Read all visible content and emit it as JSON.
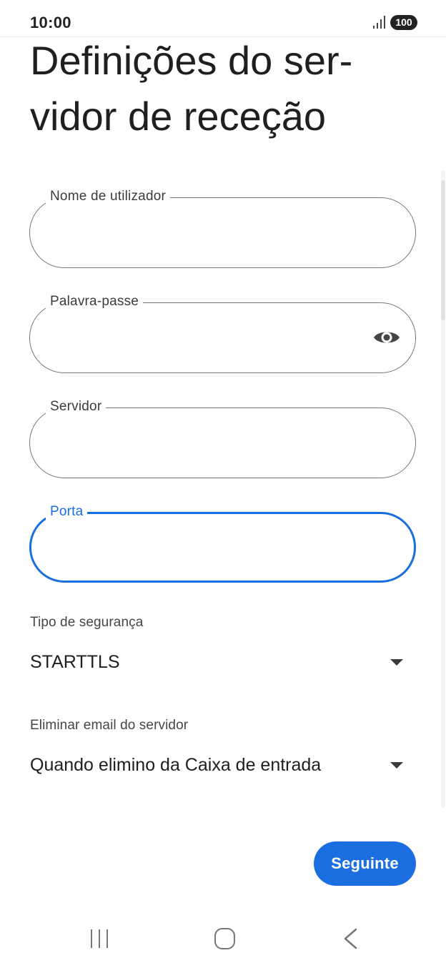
{
  "status_bar": {
    "time": "10:00",
    "battery": "100",
    "signal_icon": "signal-bars-icon"
  },
  "title": "Definições do ser-\nvidor de receção",
  "fields": {
    "username": {
      "label": "Nome de utilizador",
      "value": ""
    },
    "password": {
      "label": "Palavra-passe",
      "value": "",
      "toggle_icon": "eye-icon"
    },
    "server": {
      "label": "Servidor",
      "value": ""
    },
    "port": {
      "label": "Porta",
      "value": ""
    }
  },
  "security": {
    "label": "Tipo de segurança",
    "value": "STARTTLS"
  },
  "delete_email": {
    "label": "Eliminar email do servidor",
    "value": "Quando elimino da Caixa de entrada"
  },
  "next_button": {
    "label": "Seguinte"
  },
  "colors": {
    "accent": "#1b6ee0",
    "outline": "#747775",
    "text": "#1f1f1f"
  },
  "nav_bar": {
    "recent_icon": "recent-apps-icon",
    "home_icon": "home-icon",
    "back_icon": "back-icon"
  }
}
